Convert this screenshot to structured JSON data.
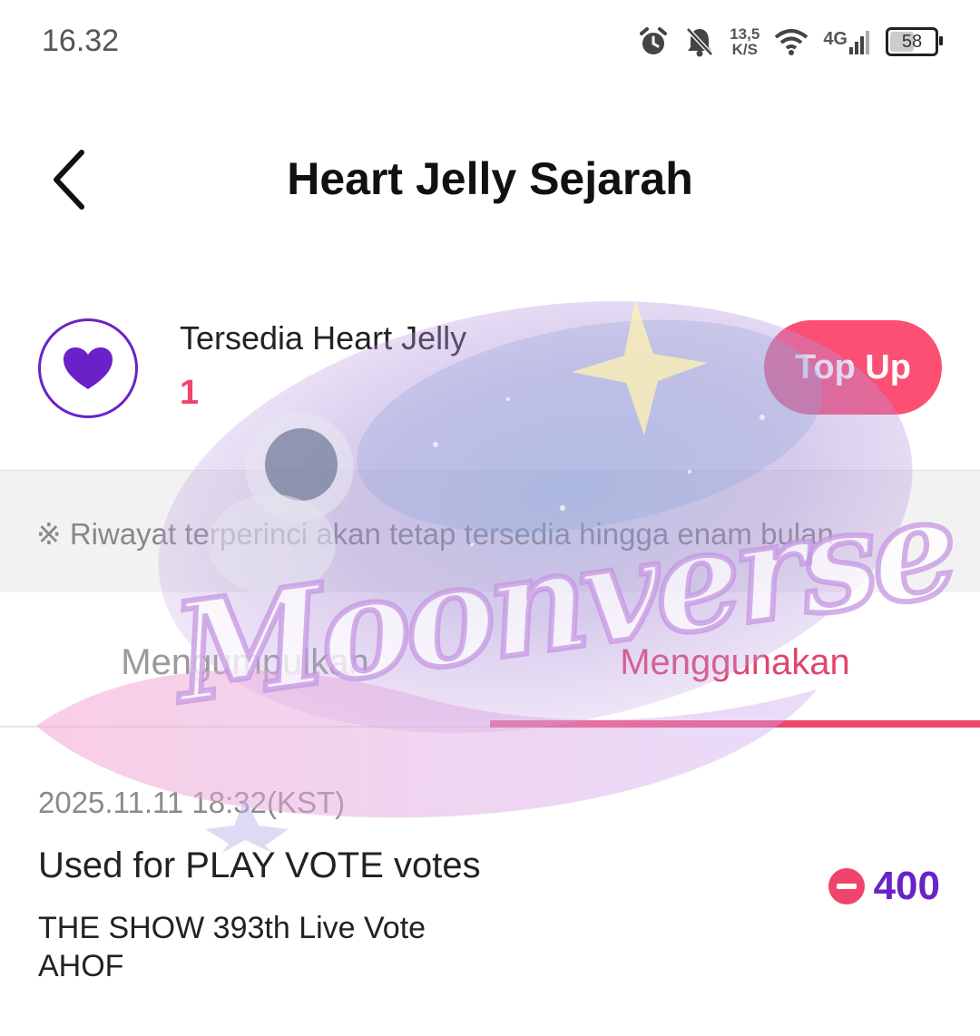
{
  "status_bar": {
    "time": "16.32",
    "speed_value": "13,5",
    "speed_unit": "K/S",
    "network": "4G",
    "battery": "58",
    "battery_level_percent": 58
  },
  "header": {
    "title": "Heart Jelly Sejarah",
    "back_icon": "chevron-left-icon"
  },
  "balance": {
    "icon": "heart-icon",
    "label": "Tersedia Heart Jelly",
    "value": "1",
    "topup_label": "Top Up"
  },
  "notice": {
    "text": "※ Riwayat terperinci akan tetap tersedia hingga enam bulan."
  },
  "tabs": [
    {
      "label": "Mengumpulkan",
      "active": false
    },
    {
      "label": "Menggunakan",
      "active": true
    }
  ],
  "transactions": [
    {
      "date": "2025.11.11 18:32(KST)",
      "title": "Used for PLAY VOTE votes",
      "description": [
        "THE SHOW 393th Live Vote",
        "AHOF"
      ],
      "amount": "400",
      "sign_icon": "minus-circle-icon"
    }
  ],
  "watermark": {
    "text": "Moonverse"
  },
  "colors": {
    "accent_pink": "#f0456b",
    "accent_purple": "#6a22c8",
    "topup_bg": "#fb4f73"
  }
}
